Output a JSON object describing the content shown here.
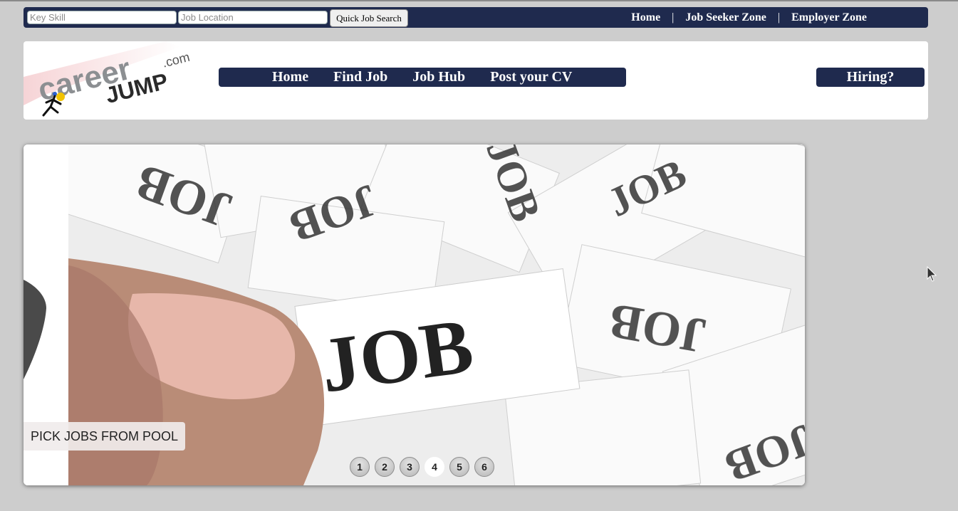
{
  "topbar": {
    "skill_placeholder": "Key Skill",
    "location_placeholder": "Job Location",
    "search_button": "Quick Job Search",
    "links": [
      "Home",
      "Job Seeker Zone",
      "Employer Zone"
    ],
    "separator": "|"
  },
  "logo": {
    "text_career": "career",
    "text_jump": "JUMP",
    "text_com": ".com"
  },
  "nav": {
    "items": [
      "Home",
      "Find Job",
      "Job Hub",
      "Post your CV"
    ],
    "hiring": "Hiring?"
  },
  "slider": {
    "caption": "PICK JOBS FROM POOL",
    "pages": [
      "1",
      "2",
      "3",
      "4",
      "5",
      "6"
    ],
    "active_page": "4",
    "image_word": "JOB"
  },
  "colors": {
    "navy": "#1f2a4e",
    "page_bg": "#cdcdcd"
  }
}
